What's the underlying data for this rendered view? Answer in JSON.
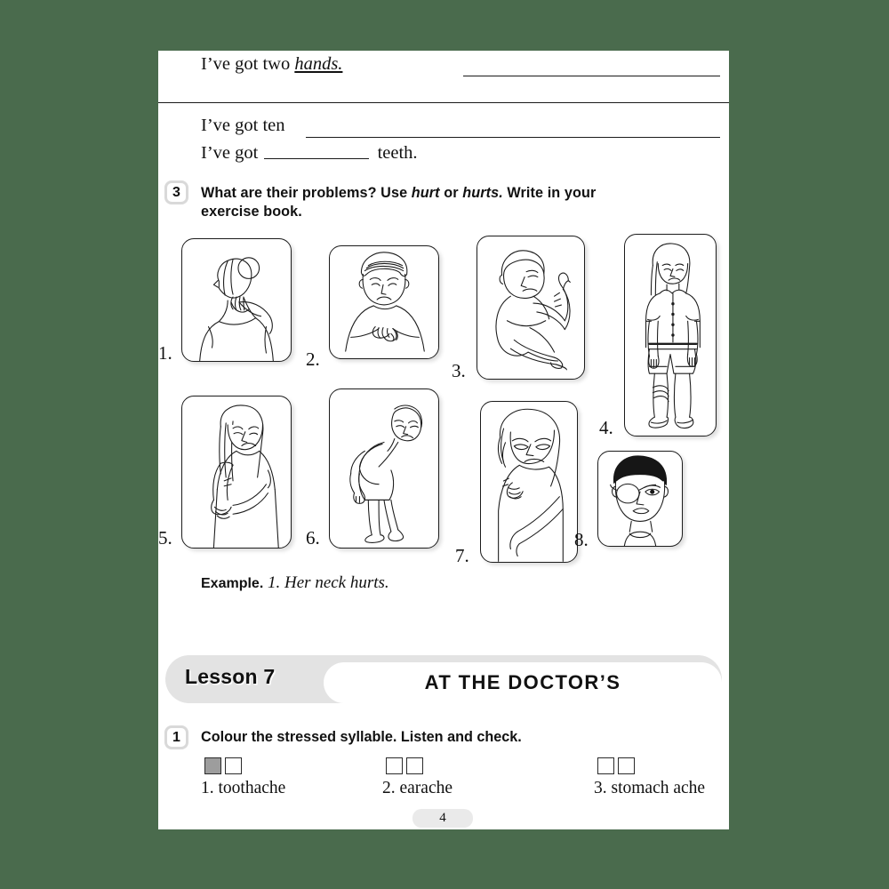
{
  "page": {
    "background_color": "#4a6b4d",
    "paper_color": "#ffffff",
    "page_number": "4"
  },
  "fill_in_lines": [
    {
      "prefix": "I’ve got two ",
      "answer": "hands.",
      "trailing_rule": true
    },
    {
      "prefix": "I’ve got ten ",
      "answer": "",
      "trailing_rule": true
    },
    {
      "prefix": "I’ve got ",
      "answer": "",
      "suffix": " teeth.",
      "trailing_rule": false
    }
  ],
  "exercise3": {
    "number": "3",
    "heading_part1": "What are their problems? Use ",
    "heading_italic1": "hurt",
    "heading_part2": " or ",
    "heading_italic2": "hurts.",
    "heading_part3": " Write in your",
    "heading_line2": "exercise book.",
    "pictures": [
      {
        "num": "1.",
        "alt": "girl holding her neck"
      },
      {
        "num": "2.",
        "alt": "boy holding his stomach"
      },
      {
        "num": "3.",
        "alt": "boy sitting holding his arm up"
      },
      {
        "num": "4.",
        "alt": "girl standing with bandaged knee"
      },
      {
        "num": "5.",
        "alt": "girl holding her arm"
      },
      {
        "num": "6.",
        "alt": "boy bending holding his back"
      },
      {
        "num": "7.",
        "alt": "girl holding her shoulder"
      },
      {
        "num": "8.",
        "alt": "boy with eye patch"
      }
    ],
    "example_label": "Example.",
    "example_sentence": "1. Her neck hurts."
  },
  "lesson": {
    "label": "Lesson 7",
    "title": "AT THE DOCTOR’S",
    "bar_color": "#e3e3e3"
  },
  "exercise1": {
    "number": "1",
    "heading": "Colour the stressed syllable. Listen and check.",
    "items": [
      {
        "label": "1. toothache",
        "boxes": [
          true,
          false
        ]
      },
      {
        "label": "2. earache",
        "boxes": [
          false,
          false
        ]
      },
      {
        "label": "3. stomach ache",
        "boxes": [
          false,
          false
        ]
      }
    ]
  }
}
